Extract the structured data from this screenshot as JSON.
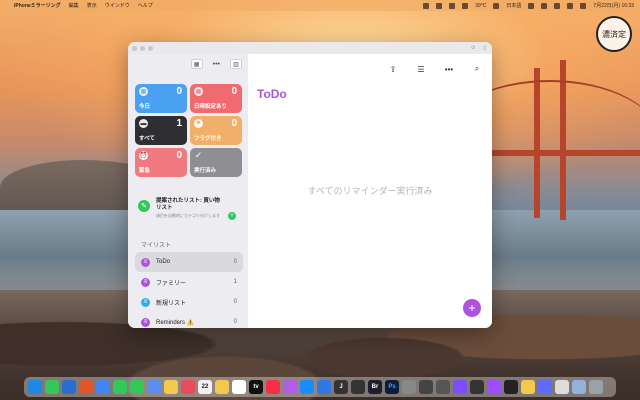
{
  "menubar": {
    "app_name": "iPhoneミラーリング",
    "menus": [
      "編集",
      "表示",
      "ウインドウ",
      "ヘルプ"
    ],
    "status": {
      "temperature": "39°C",
      "input_method": "日本語",
      "datetime": "7月22日(月) 16:33"
    }
  },
  "stamp": {
    "text": "濃済定"
  },
  "sidebar": {
    "tiles": [
      {
        "label": "今日",
        "count": "0",
        "color": "#4aa1f2",
        "icon": "calendar-icon"
      },
      {
        "label": "日時設定あり",
        "count": "0",
        "color": "#f06a72",
        "icon": "calendar-clock-icon"
      },
      {
        "label": "すべて",
        "count": "1",
        "color": "#2f2f33",
        "icon": "tray-icon"
      },
      {
        "label": "フラグ付き",
        "count": "0",
        "color": "#f1b06a",
        "icon": "flag-icon"
      },
      {
        "label": "緊急",
        "count": "0",
        "color": "#f07a7f",
        "icon": "alarm-icon"
      },
      {
        "label": "実行済み",
        "count": "",
        "color": "#8e8e93",
        "icon": "check-icon"
      }
    ],
    "suggestion": {
      "title": "提案されたリスト: 買い物リスト",
      "subtitle": "項目を自動的にカテゴリ分けします"
    },
    "my_lists_header": "マイリスト",
    "lists": [
      {
        "name": "ToDo",
        "count": "0",
        "color": "#af52de",
        "selected": true
      },
      {
        "name": "ファミリー",
        "count": "1",
        "color": "#af52de",
        "selected": false
      },
      {
        "name": "新規リスト",
        "count": "0",
        "color": "#32ade6",
        "selected": false
      },
      {
        "name": "Reminders ⚠️",
        "count": "0",
        "color": "#af52de",
        "selected": false
      }
    ]
  },
  "main": {
    "title": "ToDo",
    "empty_message": "すべてのリマインダー実行済み"
  },
  "dock": {
    "apps": [
      {
        "label": "",
        "color": "#1e88e5"
      },
      {
        "label": "",
        "color": "#34c759"
      },
      {
        "label": "",
        "color": "#2b6cd1"
      },
      {
        "label": "",
        "color": "#e0562b"
      },
      {
        "label": "",
        "color": "#4285f4"
      },
      {
        "label": "",
        "color": "#34c759"
      },
      {
        "label": "",
        "color": "#34c759"
      },
      {
        "label": "",
        "color": "#5a8dee"
      },
      {
        "label": "",
        "color": "#f2c94c"
      },
      {
        "label": "",
        "color": "#e94b5a"
      },
      {
        "label": "22",
        "color": "#f1f1f1"
      },
      {
        "label": "",
        "color": "#f2c94c"
      },
      {
        "label": "",
        "color": "#ffffff"
      },
      {
        "label": "tv",
        "color": "#111111"
      },
      {
        "label": "",
        "color": "#fa2d48"
      },
      {
        "label": "",
        "color": "#b05ee6"
      },
      {
        "label": "",
        "color": "#1a8cff"
      },
      {
        "label": "",
        "color": "#2f78e3"
      },
      {
        "label": "J",
        "color": "#333333"
      },
      {
        "label": "",
        "color": "#333333"
      },
      {
        "label": "Br",
        "color": "#1e1e2e"
      },
      {
        "label": "Ps",
        "color": "#0f1d3a"
      },
      {
        "label": "",
        "color": "#888888"
      },
      {
        "label": "",
        "color": "#444444"
      },
      {
        "label": "",
        "color": "#555555"
      },
      {
        "label": "",
        "color": "#7c4dff"
      },
      {
        "label": "",
        "color": "#333333"
      },
      {
        "label": "",
        "color": "#9b4dff"
      },
      {
        "label": "",
        "color": "#222222"
      },
      {
        "label": "",
        "color": "#f2c94c"
      },
      {
        "label": "",
        "color": "#5b6cff"
      },
      {
        "label": "",
        "color": "#dddddd"
      },
      {
        "label": "",
        "color": "#8fb3d9"
      },
      {
        "label": "",
        "color": "#9aa1a8"
      }
    ]
  }
}
